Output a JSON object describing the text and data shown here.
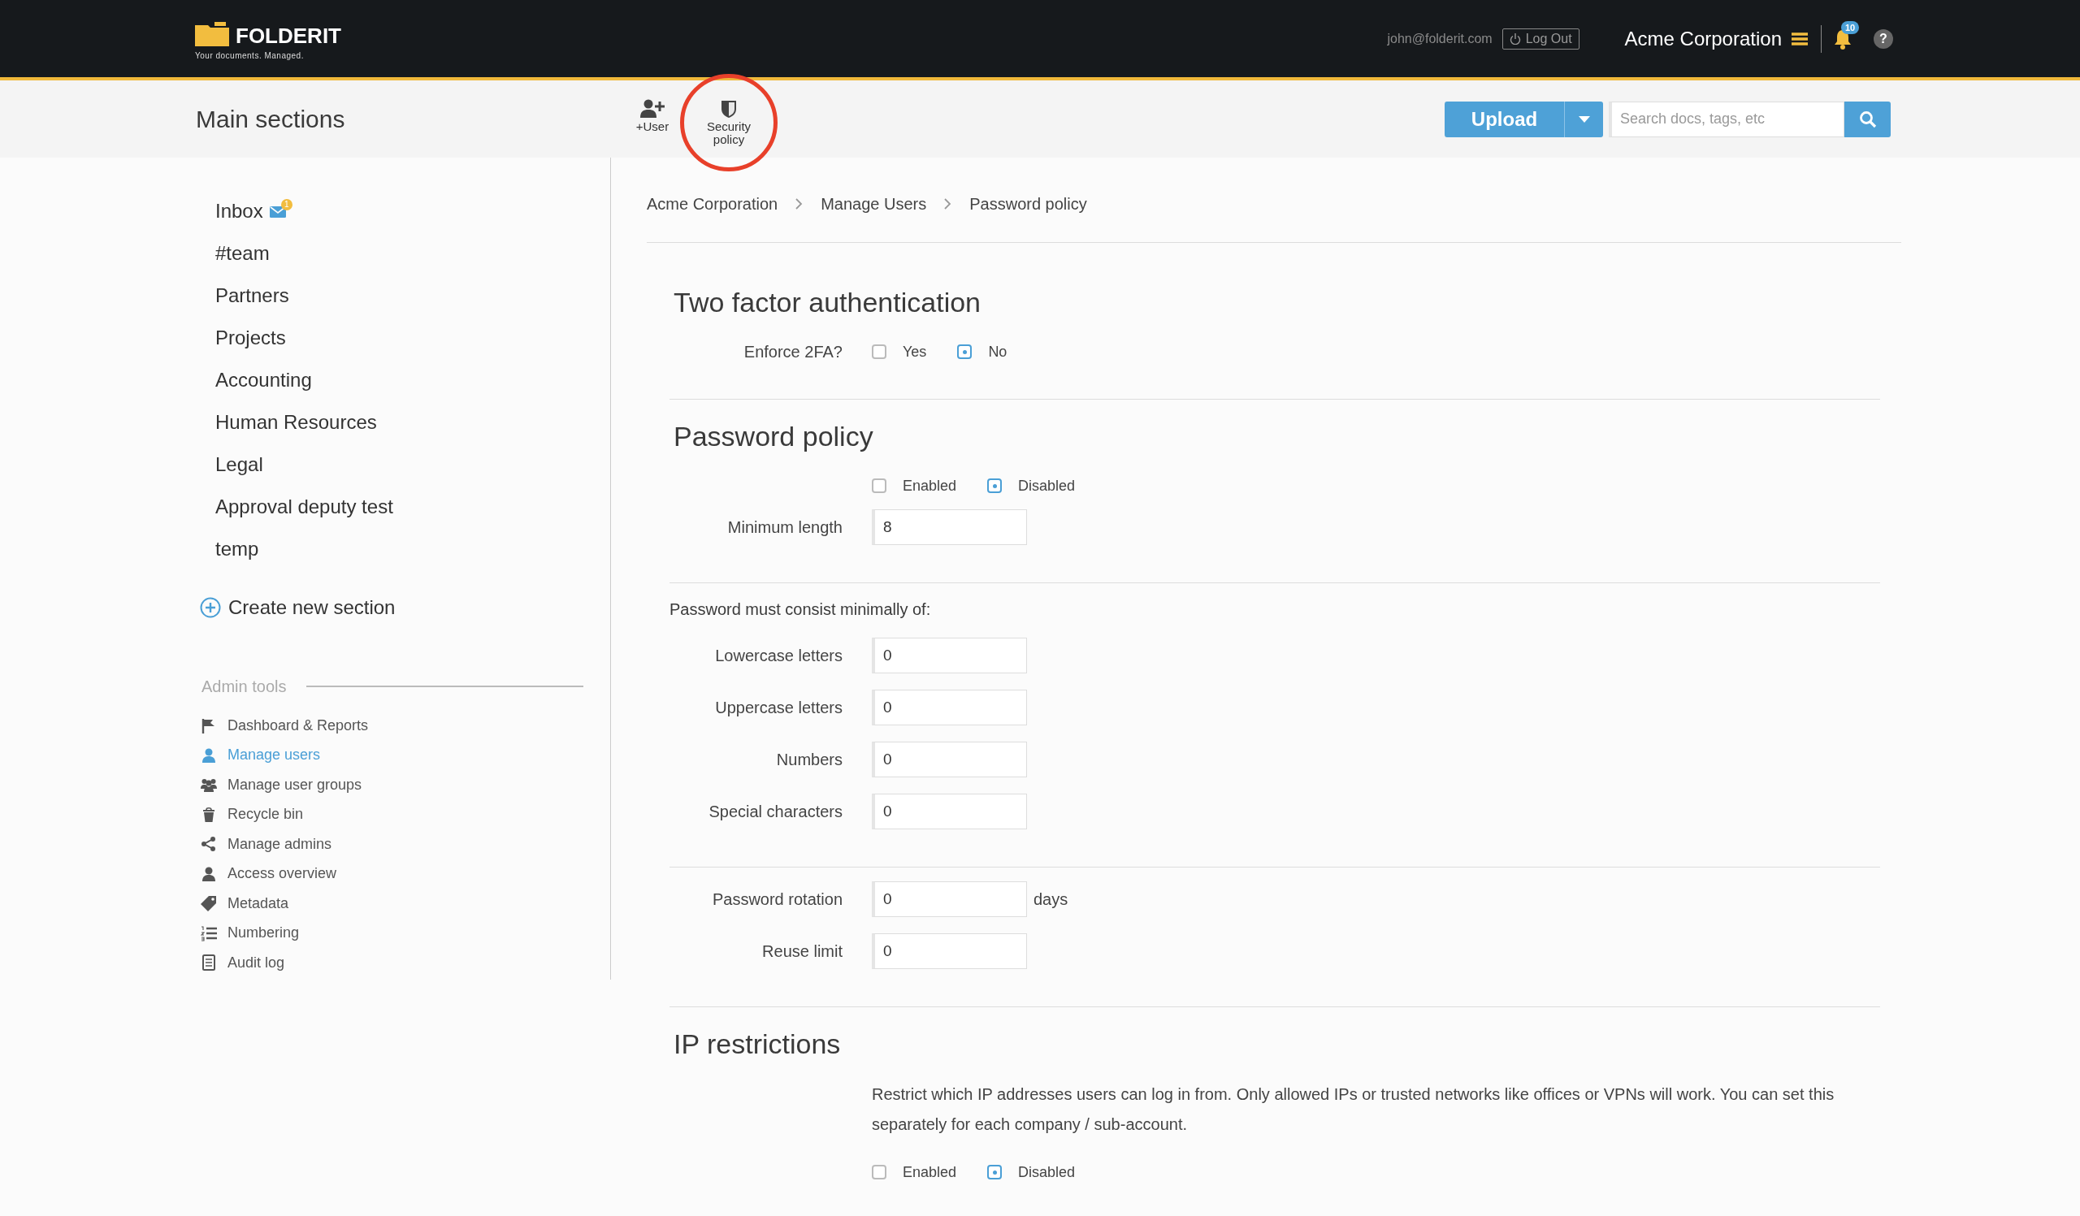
{
  "header": {
    "logo": {
      "name": "FOLDERIT",
      "tagline": "Your documents. Managed."
    },
    "user_email": "john@folderit.com",
    "logout": {
      "label": "Log Out"
    },
    "company": "Acme Corporation",
    "notifications": {
      "count": "10"
    },
    "help": {
      "label": "?"
    }
  },
  "toolbar": {
    "title": "Main sections",
    "tools": [
      {
        "label": "+User",
        "kind": "add-user",
        "circled": false
      },
      {
        "label": "Security policy",
        "kind": "shield",
        "circled": true
      }
    ],
    "upload": {
      "label": "Upload"
    },
    "search": {
      "placeholder": "Search docs, tags, etc"
    }
  },
  "sidebar": {
    "sections": [
      {
        "label": "Inbox",
        "badge": "1"
      },
      {
        "label": "#team"
      },
      {
        "label": "Partners"
      },
      {
        "label": "Projects"
      },
      {
        "label": "Accounting"
      },
      {
        "label": "Human Resources"
      },
      {
        "label": "Legal"
      },
      {
        "label": "Approval deputy test"
      },
      {
        "label": "temp"
      }
    ],
    "create_section": {
      "label": "Create new section"
    },
    "admin_tools": {
      "title": "Admin tools",
      "items": [
        {
          "label": "Dashboard & Reports",
          "kind": "flag",
          "selected": false
        },
        {
          "label": "Manage users",
          "kind": "user",
          "selected": true
        },
        {
          "label": "Manage user groups",
          "kind": "users",
          "selected": false
        },
        {
          "label": "Recycle bin",
          "kind": "bin",
          "selected": false
        },
        {
          "label": "Manage admins",
          "kind": "share",
          "selected": false
        },
        {
          "label": "Access overview",
          "kind": "user",
          "selected": false
        },
        {
          "label": "Metadata",
          "kind": "tag",
          "selected": false
        },
        {
          "label": "Numbering",
          "kind": "list",
          "selected": false
        },
        {
          "label": "Audit log",
          "kind": "doc",
          "selected": false
        }
      ]
    }
  },
  "breadcrumb": [
    "Acme Corporation",
    "Manage Users",
    "Password policy"
  ],
  "form": [
    {
      "kind": "heading",
      "text": "Two factor authentication"
    },
    {
      "kind": "radio",
      "label": "Enforce 2FA?",
      "options": [
        {
          "label": "Yes",
          "selected": false
        },
        {
          "label": "No",
          "selected": true
        }
      ]
    },
    {
      "kind": "divider"
    },
    {
      "kind": "heading",
      "text": "Password policy"
    },
    {
      "kind": "radio",
      "options": [
        {
          "label": "Enabled",
          "selected": false
        },
        {
          "label": "Disabled",
          "selected": true
        }
      ]
    },
    {
      "kind": "field",
      "label": "Minimum length",
      "value": "8"
    },
    {
      "kind": "divider"
    },
    {
      "kind": "note",
      "text": "Password must consist minimally of:"
    },
    {
      "kind": "field",
      "label": "Lowercase letters",
      "value": "0"
    },
    {
      "kind": "field",
      "label": "Uppercase letters",
      "value": "0"
    },
    {
      "kind": "field",
      "label": "Numbers",
      "value": "0"
    },
    {
      "kind": "field",
      "label": "Special characters",
      "value": "0"
    },
    {
      "kind": "divider"
    },
    {
      "kind": "field",
      "label": "Password rotation",
      "value": "0",
      "suffix": "days"
    },
    {
      "kind": "field",
      "label": "Reuse limit",
      "value": "0"
    },
    {
      "kind": "divider"
    },
    {
      "kind": "heading",
      "text": "IP restrictions"
    },
    {
      "kind": "paragraph",
      "text": "Restrict which IP addresses users can log in from. Only allowed IPs or trusted networks like offices or VPNs will work. You can set this separately for each company / sub-account."
    },
    {
      "kind": "radio",
      "options": [
        {
          "label": "Enabled",
          "selected": false
        },
        {
          "label": "Disabled",
          "selected": true
        }
      ]
    }
  ]
}
